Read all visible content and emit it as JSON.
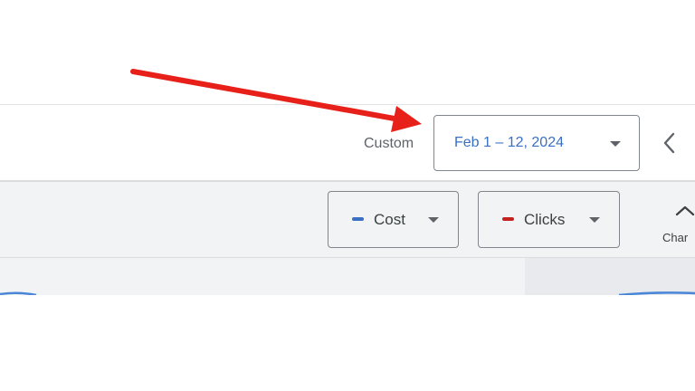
{
  "date_range": {
    "label": "Custom",
    "value": "Feb 1 – 12, 2024"
  },
  "metrics": [
    {
      "label": "Cost",
      "color": "#3a6fc4"
    },
    {
      "label": "Clicks",
      "color": "#c5221f"
    }
  ],
  "chart_toggle": {
    "label": "Char"
  },
  "colors": {
    "accent": "#3a6fc4",
    "annotation_arrow": "#e8201a",
    "line": "#4a86d8"
  },
  "icons": {
    "dropdown": "caret-down-icon",
    "prev": "chevron-left-icon",
    "chart_toggle": "chevron-up-icon"
  }
}
